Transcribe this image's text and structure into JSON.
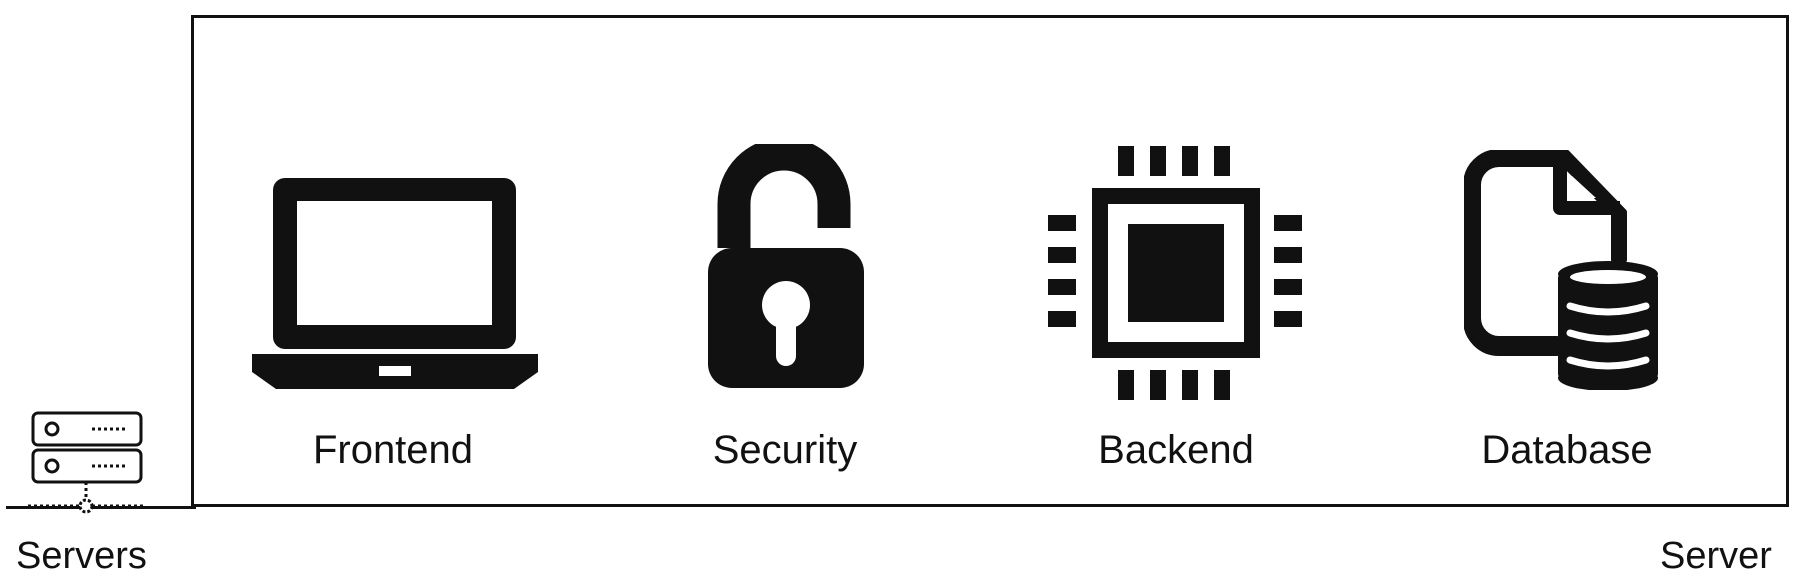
{
  "components": [
    {
      "id": "frontend",
      "label": "Frontend",
      "icon": "laptop-icon"
    },
    {
      "id": "security",
      "label": "Security",
      "icon": "unlocked-padlock-icon"
    },
    {
      "id": "backend",
      "label": "Backend",
      "icon": "cpu-chip-icon"
    },
    {
      "id": "database",
      "label": "Database",
      "icon": "database-file-icon"
    }
  ],
  "left_label": "Servers",
  "left_icon": "server-rack-icon",
  "right_label": "Server",
  "colors": {
    "stroke": "#111111",
    "background": "#ffffff"
  }
}
